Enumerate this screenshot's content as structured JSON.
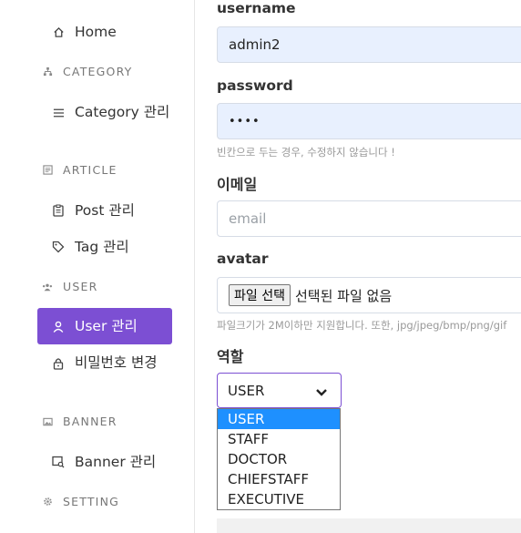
{
  "sidebar": {
    "home": "Home",
    "category_section": "CATEGORY",
    "category_manage": "Category 관리",
    "article_section": "ARTICLE",
    "post_manage": "Post 관리",
    "tag_manage": "Tag 관리",
    "user_section": "USER",
    "user_manage": "User 관리",
    "password_change": "비밀번호 변경",
    "banner_section": "BANNER",
    "banner_manage": "Banner 관리",
    "setting_section": "SETTING"
  },
  "form": {
    "username_label": "username",
    "username_value": "admin2",
    "password_label": "password",
    "password_value": "••••",
    "password_hint": "빈칸으로 두는 경우, 수정하지 않습니다 !",
    "email_label": "이메일",
    "email_placeholder": "email",
    "avatar_label": "avatar",
    "file_button": "파일 선택",
    "file_status": "선택된 파일 없음",
    "avatar_hint": "파일크기가 2M이하만 지원합니다. 또한, jpg/jpeg/bmp/png/gif",
    "role_label": "역할",
    "role_selected": "USER",
    "role_options": [
      "USER",
      "STAFF",
      "DOCTOR",
      "CHIEFSTAFF",
      "EXECUTIVE"
    ]
  },
  "colors": {
    "accent": "#7c4fd3",
    "autofill": "#e8f0fe",
    "option_highlight": "#1e90ff"
  }
}
